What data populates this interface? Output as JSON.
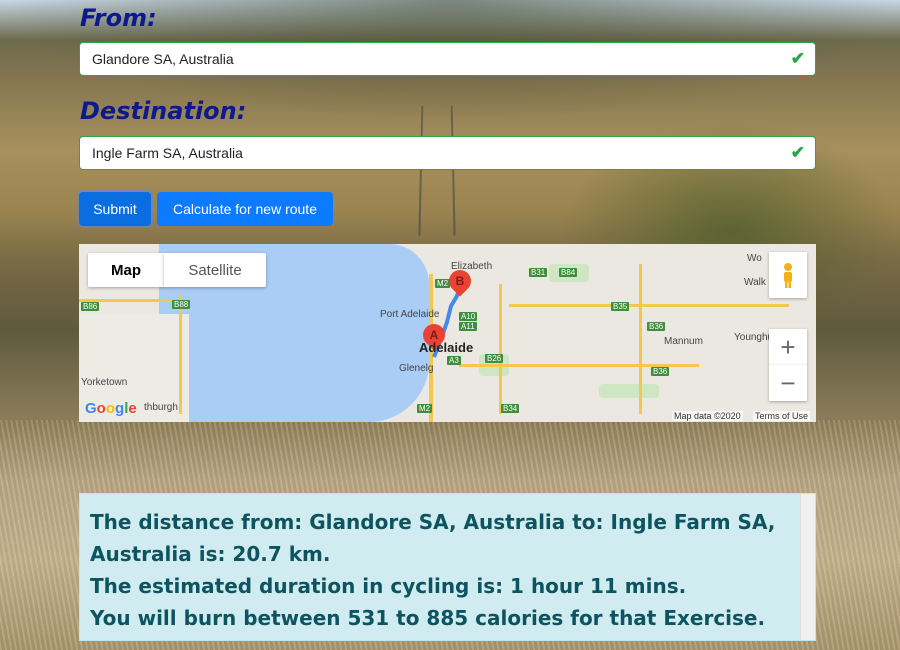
{
  "from": {
    "label": "From:",
    "value": "Glandore SA, Australia"
  },
  "destination": {
    "label": "Destination:",
    "value": "Ingle Farm SA, Australia"
  },
  "buttons": {
    "submit": "Submit",
    "calculate": "Calculate for new route"
  },
  "map": {
    "tabs": [
      "Map",
      "Satellite"
    ],
    "zoom_in": "+",
    "zoom_out": "−",
    "labels": {
      "elizabeth": "Elizabeth",
      "port_adelaide": "Port Adelaide",
      "adelaide": "Adelaide",
      "glenelg": "Glenelg",
      "yorketown": "Yorketown",
      "edithburgh": "thburgh",
      "mannum": "Mannum",
      "younghusband": "Younghusb",
      "walker": "Walk",
      "wo": "Wo"
    },
    "shields": [
      "B31",
      "B84",
      "B86",
      "B88",
      "M2",
      "A10",
      "A11",
      "B35",
      "B36",
      "B26",
      "A3",
      "B36",
      "M2",
      "B34"
    ],
    "markers": {
      "start": "A",
      "end": "B"
    },
    "logo": "Google",
    "attribution": "Map data ©2020",
    "terms": "Terms of Use"
  },
  "result": {
    "line1": "The distance from: Glandore SA, Australia to: Ingle Farm SA,",
    "line2": "Australia is: 20.7 km.",
    "line3": "The estimated duration in cycling is: 1 hour 11 mins.",
    "line4": "You will burn between 531 to 885 calories for that Exercise."
  },
  "colors": {
    "label": "#0c1a8c",
    "button": "#0d7bff",
    "valid": "#28a745",
    "result_bg": "#d1ecf1",
    "result_text": "#0c5460"
  }
}
